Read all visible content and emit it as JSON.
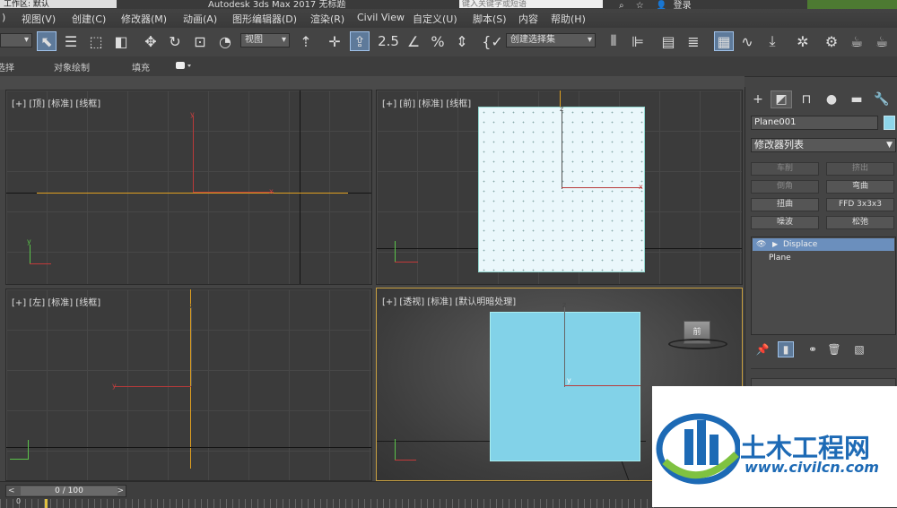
{
  "titlebar": {
    "workspace": "工作区: 默认",
    "title": "Autodesk 3ds Max 2017    无标题",
    "search_placeholder": "键入关键字或短语",
    "signin": "登录"
  },
  "menu": [
    "视图(V)",
    "创建(C)",
    "修改器(M)",
    "动画(A)",
    "图形编辑器(D)",
    "渲染(R)",
    "Civil View",
    "自定义(U)",
    "脚本(S)",
    "内容",
    "帮助(H)"
  ],
  "toolbar": {
    "coord_dropdown": "视图",
    "snap_label": "2.5",
    "selection_set": "创建选择集"
  },
  "ribbon": {
    "item1": "选择",
    "item2": "对象绘制",
    "item3": "填充"
  },
  "viewports": {
    "top": "[+] [顶] [标准] [线框]",
    "front": "[+] [前] [标准] [线框]",
    "left": "[+] [左] [标准] [线框]",
    "persp": "[+] [透视] [标准] [默认明暗处理]"
  },
  "viewcube": {
    "face": "前"
  },
  "command_panel": {
    "object_name": "Plane001",
    "object_color": "#8fd6ea",
    "modifier_list": "修改器列表",
    "buttons": [
      "车削",
      "挤出",
      "倒角",
      "弯曲",
      "扭曲",
      "FFD 3x3x3",
      "噪波",
      "松弛"
    ],
    "stack": [
      "Displace",
      "Plane"
    ]
  },
  "timeline": {
    "frame": "0 / 100",
    "ruler_start": "0"
  },
  "watermark": {
    "name": "土木工程网",
    "url": "www.civilcn.com"
  }
}
